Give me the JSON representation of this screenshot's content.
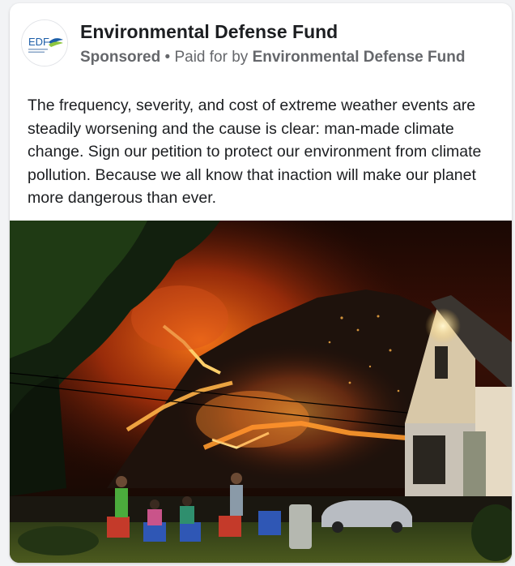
{
  "post": {
    "page_name": "Environmental Defense Fund",
    "avatar_logo_text": "EDF",
    "sponsored_label": "Sponsored",
    "separator": "•",
    "paid_for_prefix": "Paid for by",
    "paid_for_by": "Environmental Defense Fund",
    "text": "The frequency, severity, and cost of extreme weather events are steadily worsening and the cause is clear: man-made climate change. Sign our petition to protect our environment from climate pollution. Because we all know that inaction will make our planet more dangerous than ever."
  },
  "image": {
    "description_icon": "wildfire-photo"
  },
  "colors": {
    "brand_blue": "#1c5ea8",
    "brand_green": "#8ec63f",
    "muted_text": "#65676b",
    "text": "#1c1e21"
  }
}
